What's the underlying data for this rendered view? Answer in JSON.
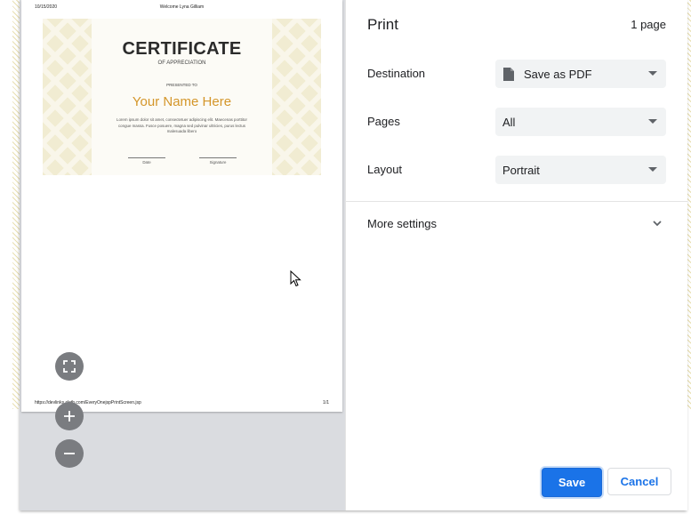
{
  "preview": {
    "header_date": "10/15/2020",
    "header_title": "Welcome Lyna Gilliam",
    "footer_url": "https://devlinks.cloth.com/EveryOnejspPrintScreen.jsp",
    "footer_page": "1/1",
    "certificate": {
      "title": "CERTIFICATE",
      "subtitle": "OF APPRECIATION",
      "presented_to": "PRESENTED TO",
      "name": "Your Name Here",
      "body": "Lorem ipsum dolor sit amet, consectetuer adipiscing elit. Maecenas porttitor congue massa. Fusce posuere, magna sed pulvinar ultricies, purus lectus malesuada libero",
      "date_label": "Date",
      "signature_label": "Signature"
    },
    "zoom_controls": [
      "fit-to-page-icon",
      "zoom-in-icon",
      "zoom-out-icon"
    ]
  },
  "panel": {
    "title": "Print",
    "page_count": "1 page",
    "destination": {
      "label": "Destination",
      "value": "Save as PDF",
      "icon": "document-icon"
    },
    "pages": {
      "label": "Pages",
      "value": "All"
    },
    "layout": {
      "label": "Layout",
      "value": "Portrait"
    },
    "more_settings": "More settings",
    "save_label": "Save",
    "cancel_label": "Cancel"
  },
  "colors": {
    "accent": "#1a73e8",
    "certificate_name": "#d4962a",
    "select_bg": "#f1f3f4",
    "preview_bg": "#dadce0"
  }
}
